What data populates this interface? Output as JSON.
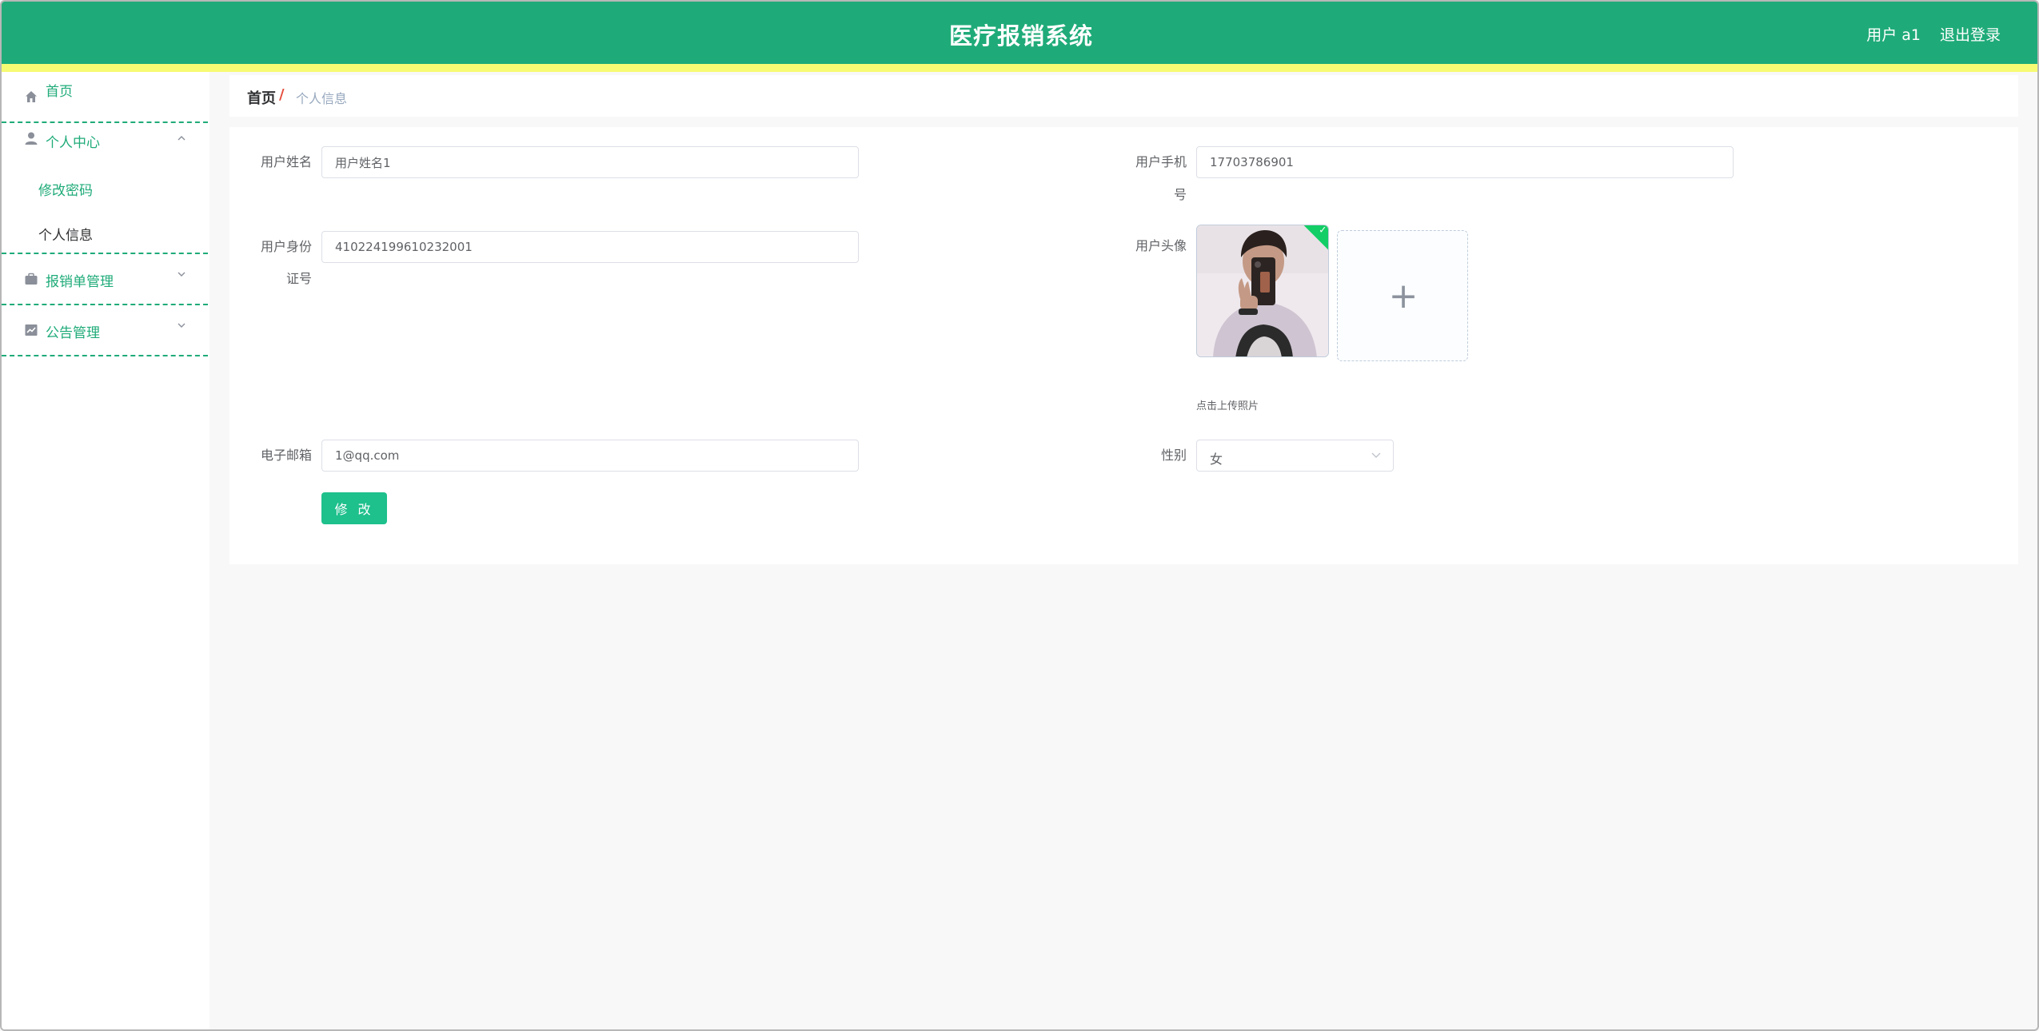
{
  "header": {
    "title": "医疗报销系统",
    "user": "用户 a1",
    "logout": "退出登录"
  },
  "sidebar": {
    "home": "首页",
    "personal_center": "个人中心",
    "change_password": "修改密码",
    "personal_info": "个人信息",
    "reimbursement_mgmt": "报销单管理",
    "notice_mgmt": "公告管理"
  },
  "breadcrumb": {
    "home": "首页",
    "separator": "/",
    "current": "个人信息"
  },
  "form": {
    "name_label": "用户姓名",
    "name_value": "用户姓名1",
    "phone_label_line1": "用户手机",
    "phone_label_line2": "号",
    "phone_value": "17703786901",
    "id_label_line1": "用户身份",
    "id_label_line2": "证号",
    "id_value": "410224199610232001",
    "avatar_label": "用户头像",
    "upload_tip": "点击上传照片",
    "upload_plus": "+",
    "email_label": "电子邮箱",
    "email_value": "1@qq.com",
    "gender_label": "性别",
    "gender_value": "女",
    "submit": "修 改"
  },
  "colors": {
    "primary": "#1fab79",
    "stripe": "#f6fb73",
    "button": "#1ec08c",
    "breadcrumb_separator": "#e54c3c"
  },
  "icons": [
    "home-icon",
    "user-icon",
    "briefcase-icon",
    "chart-icon",
    "chevron-up-icon",
    "chevron-down-icon",
    "check-icon",
    "plus-icon"
  ]
}
